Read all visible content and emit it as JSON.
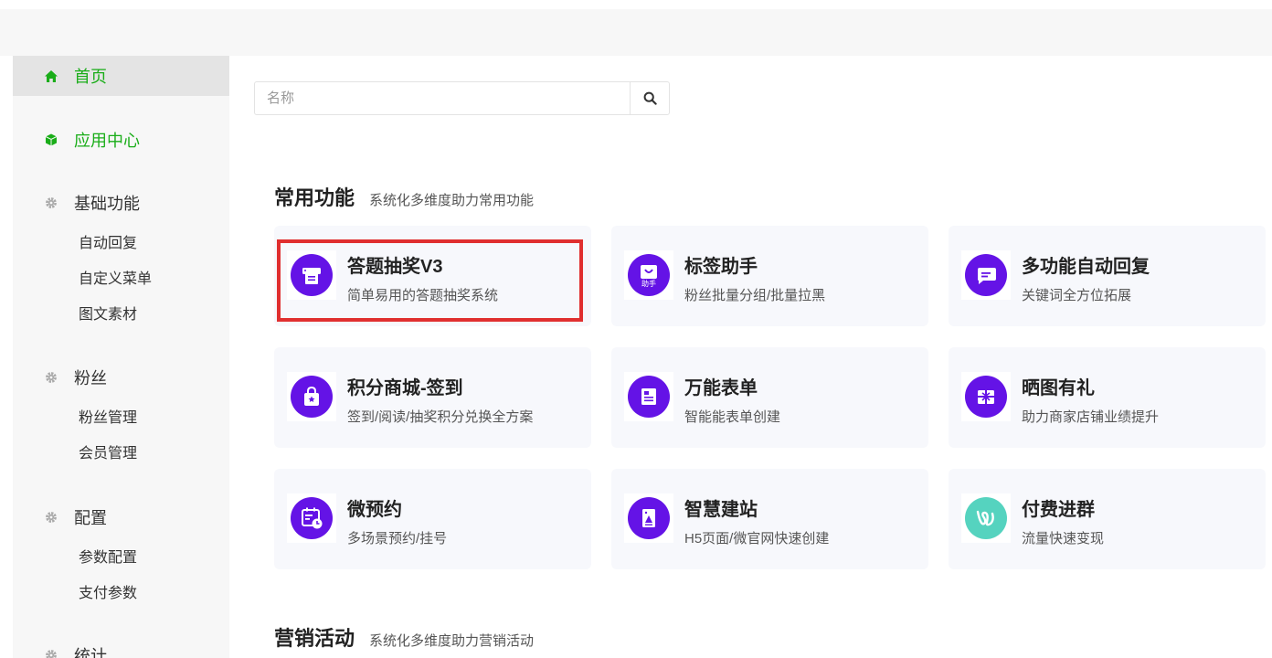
{
  "sidebar": {
    "groups": [
      {
        "label": "首页",
        "icon": "home-icon",
        "active": true,
        "green": true,
        "items": []
      },
      {
        "label": "应用中心",
        "icon": "cube-icon",
        "green": true,
        "items": []
      },
      {
        "label": "基础功能",
        "icon": "gear-icon",
        "items": [
          "自动回复",
          "自定义菜单",
          "图文素材"
        ]
      },
      {
        "label": "粉丝",
        "icon": "gear-icon",
        "items": [
          "粉丝管理",
          "会员管理"
        ]
      },
      {
        "label": "配置",
        "icon": "gear-icon",
        "items": [
          "参数配置",
          "支付参数"
        ]
      },
      {
        "label": "统计",
        "icon": "gear-icon",
        "items": []
      }
    ]
  },
  "search": {
    "placeholder": "名称",
    "value": "",
    "icon": "search-icon"
  },
  "sections": [
    {
      "title": "常用功能",
      "subtitle": "系统化多维度助力常用功能"
    },
    {
      "title": "营销活动",
      "subtitle": "系统化多维度助力营销活动"
    }
  ],
  "apps": [
    {
      "name": "答题抽奖V3",
      "desc": "简单易用的答题抽奖系统",
      "icon": "printer-icon"
    },
    {
      "name": "标签助手",
      "desc": "粉丝批量分组/批量拉黑",
      "icon": "tag-bag-icon",
      "icon_text": "助手"
    },
    {
      "name": "多功能自动回复",
      "desc": "关键词全方位拓展",
      "icon": "chat-bubble-icon"
    },
    {
      "name": "积分商城-签到",
      "desc": "签到/阅读/抽奖积分兑换全方案",
      "icon": "shopping-bag-icon"
    },
    {
      "name": "万能表单",
      "desc": "智能能表单创建",
      "icon": "form-icon"
    },
    {
      "name": "晒图有礼",
      "desc": "助力商家店铺业绩提升",
      "icon": "gift-icon"
    },
    {
      "name": "微预约",
      "desc": "多场景预约/挂号",
      "icon": "calendar-clock-icon"
    },
    {
      "name": "智慧建站",
      "desc": "H5页面/微官网快速创建",
      "icon": "site-page-icon"
    },
    {
      "name": "付费进群",
      "desc": "流量快速变现",
      "icon": "group-logo-icon"
    }
  ],
  "colors": {
    "accent_green": "#1aad19",
    "icon_purple": "#6413e6",
    "icon_teal": "#55d3bf",
    "highlight_red": "#e02f2f"
  }
}
